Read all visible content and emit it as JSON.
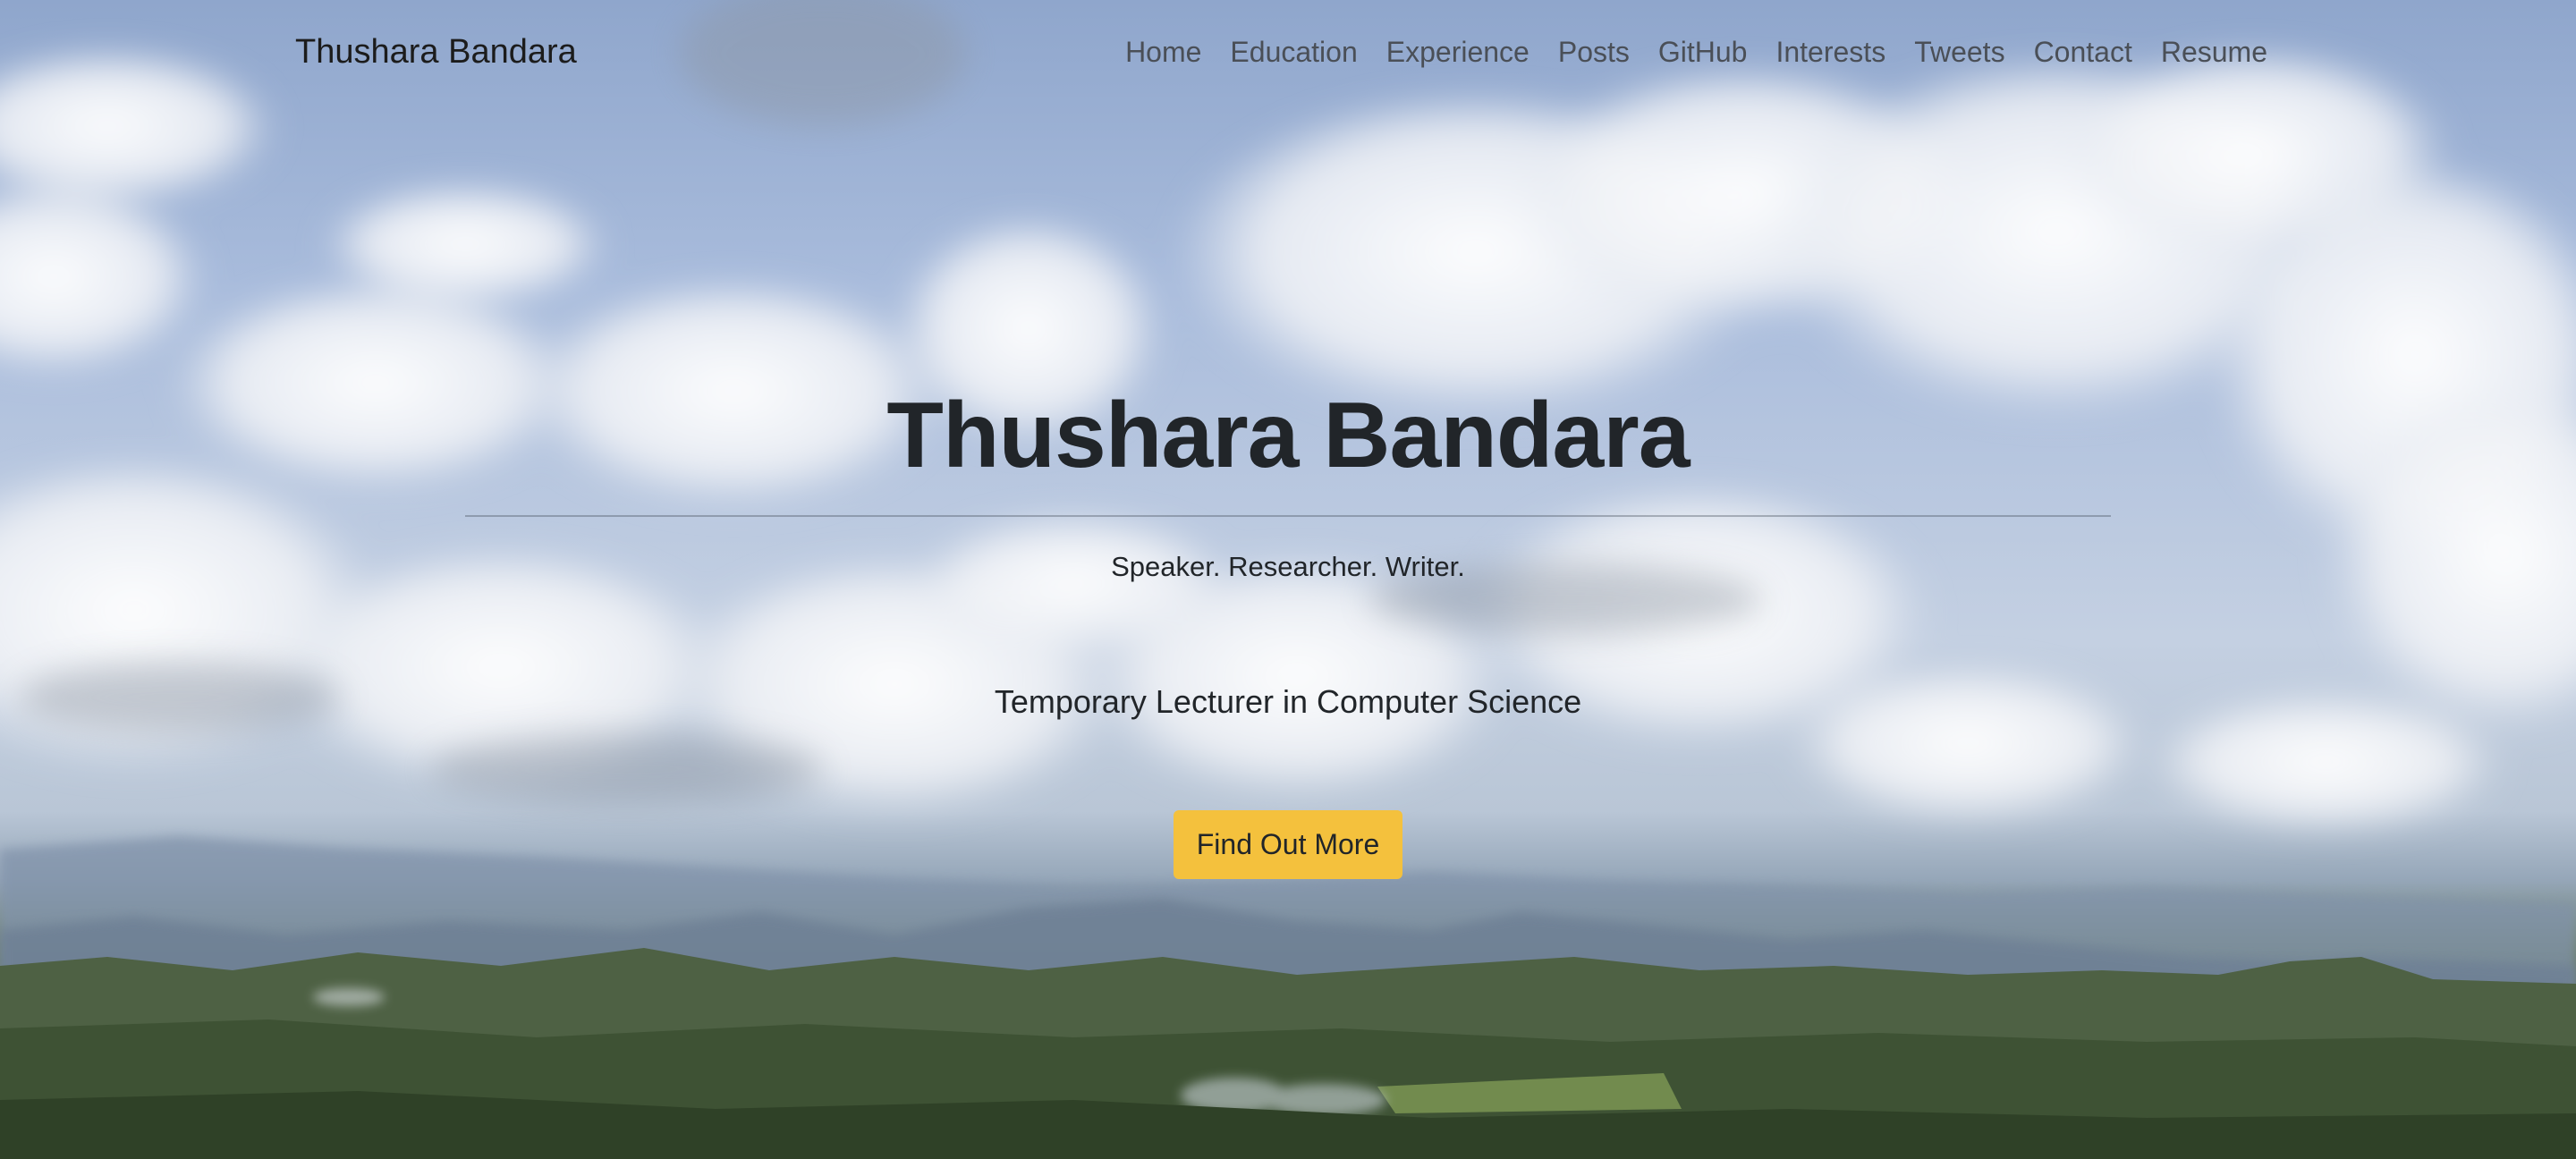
{
  "navbar": {
    "brand": "Thushara Bandara",
    "links": [
      {
        "label": "Home"
      },
      {
        "label": "Education"
      },
      {
        "label": "Experience"
      },
      {
        "label": "Posts"
      },
      {
        "label": "GitHub"
      },
      {
        "label": "Interests"
      },
      {
        "label": "Tweets"
      },
      {
        "label": "Contact"
      },
      {
        "label": "Resume"
      }
    ]
  },
  "hero": {
    "title": "Thushara Bandara",
    "tagline": "Speaker. Researcher. Writer.",
    "role": "Temporary Lecturer in Computer Science",
    "cta_label": "Find Out More"
  },
  "colors": {
    "accent": "#f4c13d",
    "text": "#212529",
    "nav_text": "#4a4f57"
  }
}
